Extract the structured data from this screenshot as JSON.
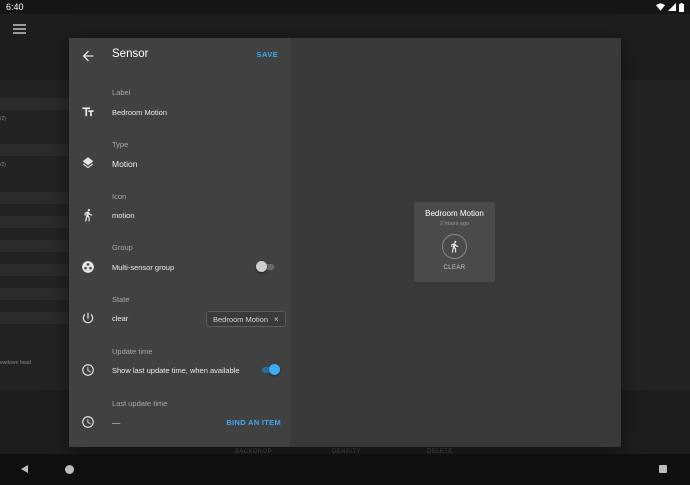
{
  "status_bar": {
    "time": "6:40"
  },
  "background": {
    "row_texts": [
      "/2)",
      "/2)",
      "ewdown head"
    ],
    "footer": [
      "BACKDROP",
      "DENSITY",
      "DELETE"
    ]
  },
  "dialog": {
    "title": "Sensor",
    "save_label": "SAVE",
    "fields": {
      "label": {
        "label": "Label",
        "value": "Bedroom Motion"
      },
      "type": {
        "label": "Type",
        "value": "Motion"
      },
      "icon": {
        "label": "Icon",
        "value": "motion"
      },
      "group": {
        "label": "Group",
        "value": "Multi-sensor group",
        "enabled": false
      },
      "state": {
        "label": "State",
        "value": "clear",
        "chip": "Bedroom Motion",
        "chip_close": "×"
      },
      "update_time": {
        "label": "Update time",
        "value": "Show last update time, when available",
        "enabled": true
      },
      "last_update_time": {
        "label": "Last update time",
        "value": "––",
        "action": "BIND AN ITEM"
      }
    },
    "icons": [
      "back-arrow-icon",
      "text-format-icon",
      "layers-icon",
      "walking-person-icon",
      "group-icon",
      "power-icon",
      "clock-icon",
      "clock-icon"
    ]
  },
  "preview_card": {
    "title": "Bedroom Motion",
    "subtitle": "2 hours ago",
    "state": "CLEAR",
    "icon": "walking-person-icon"
  },
  "colors": {
    "accent": "#3fa9f5",
    "panel": "#414141",
    "preview": "#393939",
    "card": "#4a4a4a"
  }
}
